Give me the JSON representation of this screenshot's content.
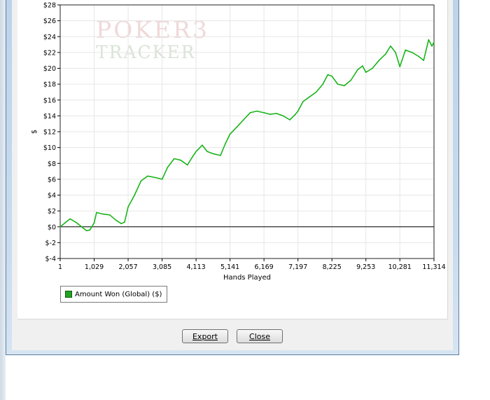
{
  "watermark": {
    "line1": "POKER3",
    "line2": "TRACKER"
  },
  "chart_data": {
    "type": "line",
    "title": "",
    "xlabel": "Hands Played",
    "ylabel": "$",
    "xlim": [
      1,
      11314
    ],
    "ylim": [
      -4,
      28
    ],
    "x_ticks": [
      1,
      1029,
      2057,
      3085,
      4113,
      5141,
      6169,
      7197,
      8225,
      9253,
      10281,
      11314
    ],
    "x_tick_labels": [
      "1",
      "1,029",
      "2,057",
      "3,085",
      "4,113",
      "5,141",
      "6,169",
      "7,197",
      "8,225",
      "9,253",
      "10,281",
      "11,314"
    ],
    "y_ticks": [
      -4,
      -2,
      0,
      2,
      4,
      6,
      8,
      10,
      12,
      14,
      16,
      18,
      20,
      22,
      24,
      26,
      28
    ],
    "y_tick_labels": [
      "$-4",
      "$-2",
      "$0",
      "$2",
      "$4",
      "$6",
      "$8",
      "$10",
      "$12",
      "$14",
      "$16",
      "$18",
      "$20",
      "$22",
      "$24",
      "$26",
      "$28"
    ],
    "grid": true,
    "zero_line": 0,
    "legend_position": "bottom-left",
    "series": [
      {
        "name": "Amount Won (Global) ($)",
        "color": "#19b419",
        "x": [
          1,
          150,
          300,
          500,
          650,
          800,
          900,
          1029,
          1100,
          1300,
          1500,
          1700,
          1850,
          1950,
          2057,
          2250,
          2450,
          2650,
          2900,
          3085,
          3250,
          3450,
          3650,
          3850,
          4000,
          4113,
          4300,
          4450,
          4650,
          4850,
          5000,
          5141,
          5350,
          5550,
          5750,
          5950,
          6169,
          6350,
          6550,
          6750,
          6950,
          7100,
          7197,
          7350,
          7550,
          7750,
          7950,
          8100,
          8225,
          8400,
          8600,
          8800,
          9000,
          9150,
          9253,
          9450,
          9650,
          9850,
          10000,
          10150,
          10281,
          10450,
          10650,
          10850,
          11000,
          11150,
          11250,
          11314
        ],
        "y": [
          0,
          0.5,
          1.0,
          0.5,
          0.0,
          -0.5,
          -0.4,
          0.5,
          1.8,
          1.6,
          1.5,
          0.8,
          0.4,
          0.6,
          2.5,
          4.0,
          5.8,
          6.4,
          6.2,
          6.0,
          7.5,
          8.6,
          8.4,
          7.8,
          8.8,
          9.5,
          10.3,
          9.5,
          9.2,
          9.0,
          10.5,
          11.7,
          12.6,
          13.5,
          14.4,
          14.6,
          14.4,
          14.2,
          14.3,
          14.0,
          13.5,
          14.1,
          14.6,
          15.8,
          16.4,
          17.0,
          18.0,
          19.2,
          19.0,
          18.0,
          17.8,
          18.5,
          19.8,
          20.3,
          19.5,
          20.0,
          21.0,
          21.8,
          22.8,
          22.0,
          20.2,
          22.3,
          22.0,
          21.5,
          21.0,
          23.6,
          22.8,
          23.3
        ]
      }
    ]
  },
  "buttons": {
    "export": "Export",
    "close": "Close"
  }
}
